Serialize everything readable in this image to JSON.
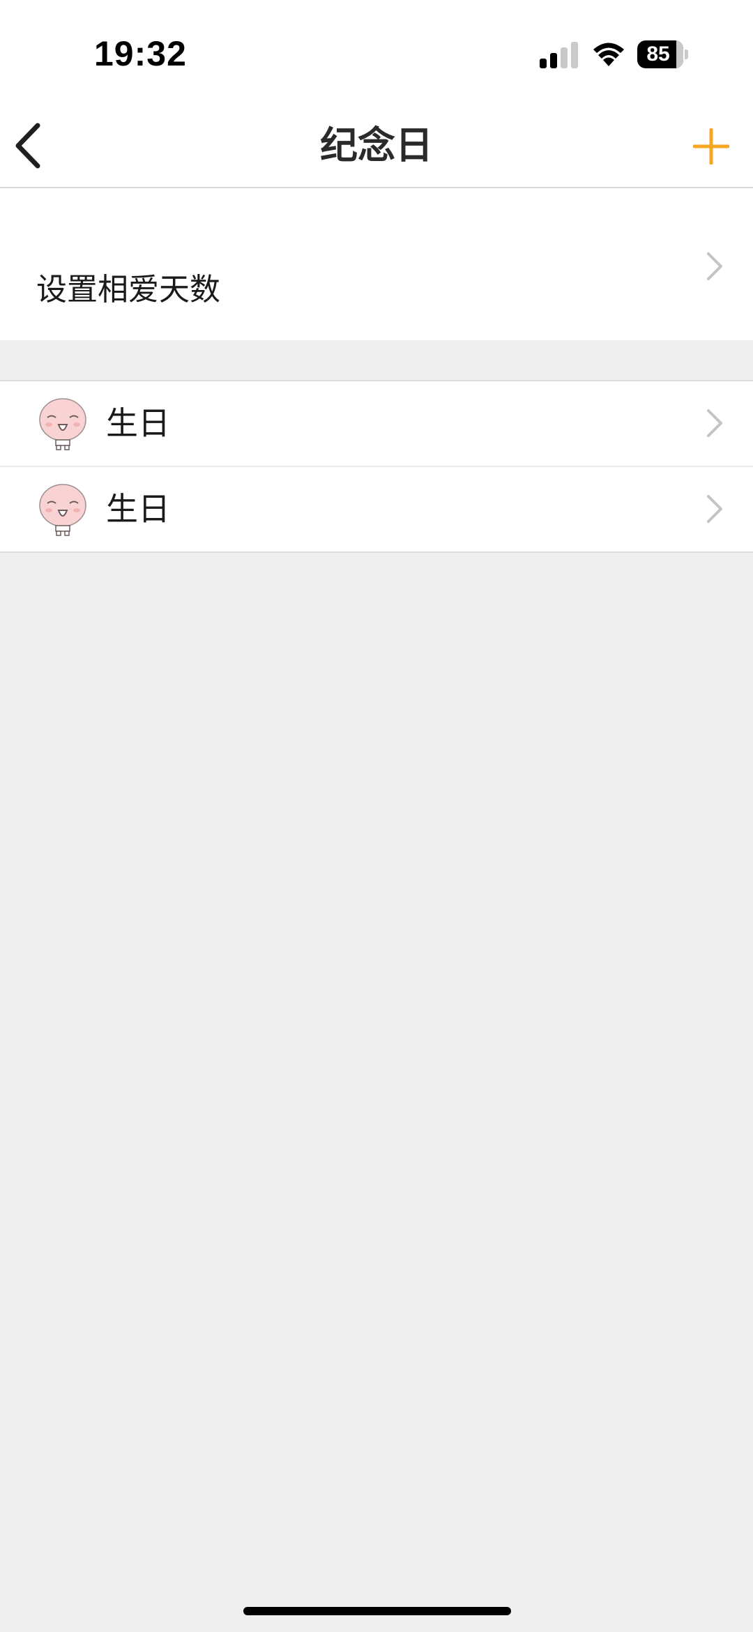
{
  "status_bar": {
    "time": "19:32",
    "battery_level": 85,
    "battery_text": "85",
    "signal_bars_active": 2,
    "signal_bars_total": 4
  },
  "nav": {
    "title": "纪念日",
    "back_icon": "chevron-left-icon",
    "add_icon": "plus-icon",
    "accent_color": "#f5a623"
  },
  "love_days": {
    "label": "设置相爱天数"
  },
  "anniversaries": [
    {
      "label": "生日",
      "icon": "bald-face-avatar-icon"
    },
    {
      "label": "生日",
      "icon": "bald-face-avatar-icon"
    }
  ],
  "colors": {
    "background": "#efefef",
    "surface": "#ffffff",
    "chevron": "#c4c4c4",
    "avatar_face": "#f9d3d3"
  }
}
